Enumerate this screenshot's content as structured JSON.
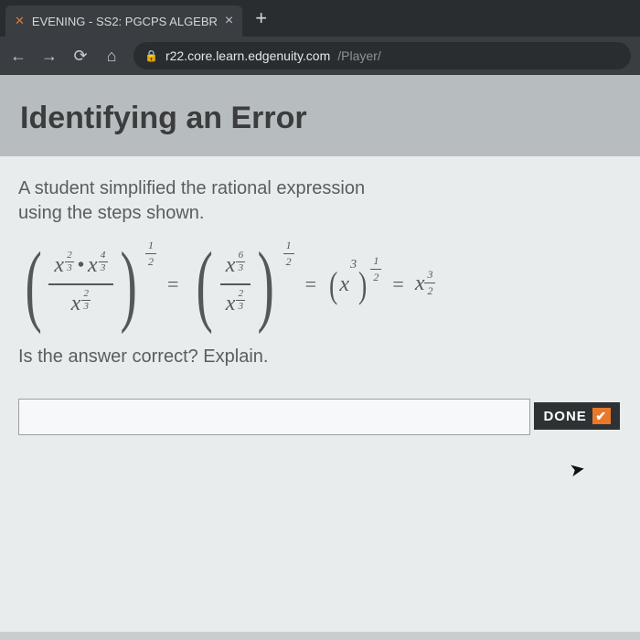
{
  "browser": {
    "tab_title": "EVENING - SS2: PGCPS ALGEBR",
    "tab_close": "×",
    "new_tab": "+",
    "nav": {
      "back": "←",
      "forward": "→",
      "reload": "⟳",
      "home": "⌂"
    },
    "url_lock": "🔒",
    "url_host": "r22.core.learn.edgenuity.com",
    "url_path": "/Player/"
  },
  "page": {
    "title": "Identifying an Error",
    "prompt_line1": "A student simplified the rational expression",
    "prompt_line2": "using the steps shown.",
    "question": "Is the answer correct? Explain.",
    "answer_value": "",
    "done_label": "DONE",
    "done_check": "✔"
  },
  "math": {
    "eq": "=",
    "dot": "•",
    "x": "x",
    "outer_exp_num": "1",
    "outer_exp_den": "2",
    "t1_num1_n": "2",
    "t1_num1_d": "3",
    "t1_num2_n": "4",
    "t1_num2_d": "3",
    "t1_den_n": "2",
    "t1_den_d": "3",
    "t2_num_n": "6",
    "t2_num_d": "3",
    "t2_den_n": "2",
    "t2_den_d": "3",
    "t3_inner": "3",
    "t3_on": "1",
    "t3_od": "2",
    "final_n": "3",
    "final_d": "2"
  }
}
